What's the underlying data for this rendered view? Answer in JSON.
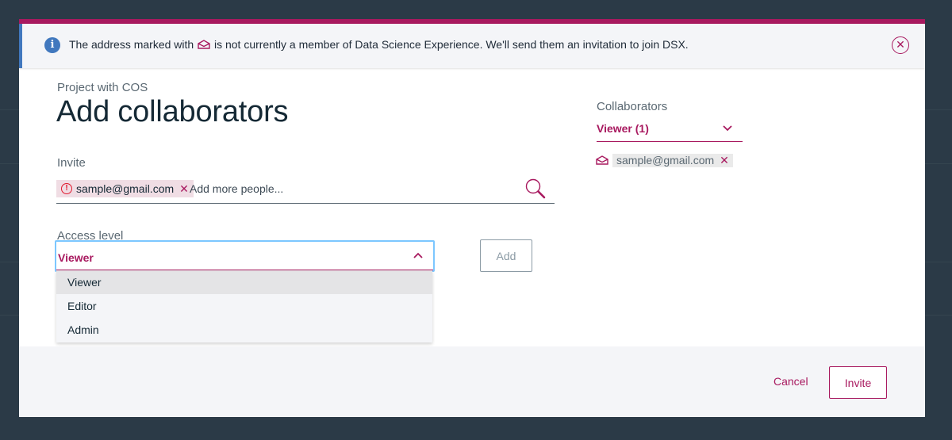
{
  "notice": {
    "text_before": "The address marked with",
    "text_after": "is not currently a member of Data Science Experience. We'll send them an invitation to join DSX.",
    "icon": "info-icon",
    "close_icon": "close-icon"
  },
  "header": {
    "project_name": "Project with COS",
    "title": "Add collaborators"
  },
  "invite": {
    "label": "Invite",
    "tag_email": "sample@gmail.com",
    "placeholder": "Add more people..."
  },
  "access": {
    "label": "Access level",
    "selected": "Viewer",
    "options": [
      "Viewer",
      "Editor",
      "Admin"
    ],
    "add_label": "Add"
  },
  "collaborators": {
    "title": "Collaborators",
    "filter_value": "Viewer (1)",
    "items": [
      {
        "email": "sample@gmail.com",
        "icon": "envelope-icon"
      }
    ]
  },
  "footer": {
    "cancel_label": "Cancel",
    "invite_label": "Invite"
  },
  "colors": {
    "accent": "#a8195f",
    "info": "#4178be",
    "error": "#e0182d",
    "focus": "#7cc7ff"
  }
}
